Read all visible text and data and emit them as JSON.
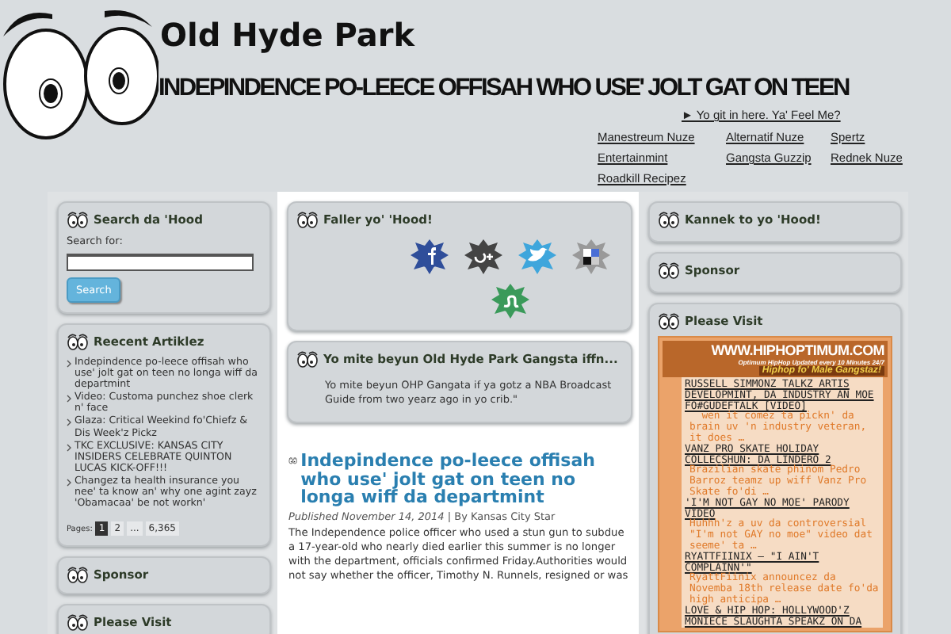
{
  "site": {
    "title": "Old Hyde Park",
    "headline": "INDEPINDENCE PO-LEECE OFFISAH WHO USE' JOLT GAT ON TEEN",
    "tagline_link": "► Yo git in here. Ya' Feel Me?"
  },
  "nav": [
    "Manestreum Nuze",
    "Alternatif Nuze",
    "Spertz",
    "Entertainmint",
    "Gangsta Guzzip",
    "Rednek Nuze",
    "Roadkill Recipez"
  ],
  "left": {
    "search": {
      "title": "Search da 'Hood",
      "label": "Search for:",
      "button": "Search"
    },
    "recent": {
      "title": "Reecent Artiklez",
      "items": [
        "Indepindence po-leece offisah who use' jolt gat on teen no longa wiff da departmint",
        "Video: Customa punchez shoe clerk n' face",
        "Glaza: Critical Weekind fo'Chiefz & Dis Week'z Pickz",
        "TKC EXCLUSIVE: KANSAS CITY INSIDERS CELEBRATE QUINTON LUCAS KICK-OFF!!!",
        "Changez ta health insurance you nee' ta know an' why one agint zayz 'Obamacaa' be not workn'"
      ],
      "pages_label": "Pages:",
      "pages": [
        {
          "label": "1",
          "selected": true
        },
        {
          "label": "2",
          "selected": false
        },
        {
          "label": "...",
          "selected": false
        },
        {
          "label": "6,365",
          "selected": false
        }
      ]
    },
    "sponsor": {
      "title": "Sponsor"
    },
    "visit": {
      "title": "Please Visit"
    }
  },
  "center": {
    "follow": {
      "title": "Faller yo' 'Hood!"
    },
    "quote": {
      "title": "Yo mite beyun Old Hyde Park Gangsta iffn...",
      "text": "Yo mite beyun OHP Gangata if ya gotz a NBA Broadcast Guide from two yearz ago in yo crib.\""
    },
    "article": {
      "title": "Indepindence po-leece offisah who use' jolt gat on teen no longa wiff da departmint",
      "meta": "*Published November 14, 2014 |* By Kansas City Star",
      "body": "The Independence police officer who used a stun gun to subdue a 17-year-old who nearly died earlier this summer is no longer with the department, officials confirmed Friday.Authorities would not say whether the officer, Timothy N. Runnels, resigned or was"
    }
  },
  "right": {
    "connect": {
      "title": "Kannek to yo 'Hood!"
    },
    "sponsor": {
      "title": "Sponsor"
    },
    "visit": {
      "title": "Please Visit",
      "banner_url": "WWW.HIPHOPTIMUM.COM",
      "banner_sub": "Optimum HipHop Updated every 10 Minutes 24/7",
      "banner_slogan": "Hiphop fo' Male Gangstaz!",
      "feed": [
        {
          "headline": "RUSSELL SIMMONZ TALKZ ARTIS DEVELOPMINT, DA INDUSTRY AN MOE FO#GUDEFTALK [VIDEO]",
          "excerpt": "  wen it comez ta pickn' da brain uv 'n industry veteran, it does …"
        },
        {
          "headline": "VANZ PRO SKATE HOLIDAY COLLECSHUN: DA LINDERO 2",
          "excerpt": "Brazilian skate phinom Pedro Barroz teamz up wiff Vanz Pro Skate fo'di …"
        },
        {
          "headline": "'I'M NOT GAY NO MOE' PARODY VIDEO",
          "excerpt": "Huhhh'z a uv da controversial \"I'm not GAY no moe\" video dat seeme' ta …"
        },
        {
          "headline": "RYATTFIINIX – \"I AIN'T COMPLAINN'\"",
          "excerpt": "RyattFiinix announcez da Novemba 18th release date fo'da high anticipa …"
        },
        {
          "headline": "LOVE & HIP HOP: HOLLYWOOD'Z MONIECE SLAUGHTA SPEAKZ ON DA"
        }
      ]
    }
  }
}
